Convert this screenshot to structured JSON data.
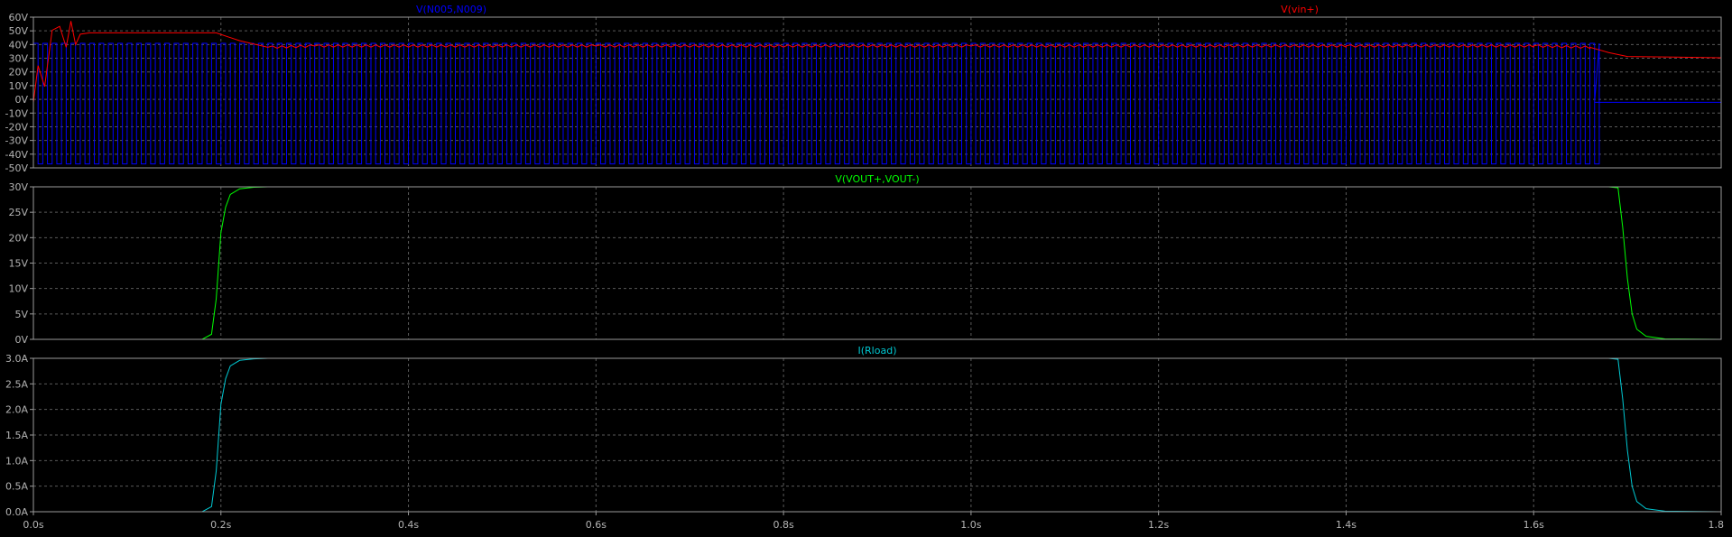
{
  "chart_data": [
    {
      "type": "line",
      "panel": "top",
      "ylim": [
        -50,
        65
      ],
      "yticks": [
        "60V",
        "50V",
        "40V",
        "30V",
        "20V",
        "10V",
        "0V",
        "-10V",
        "-20V",
        "-30V",
        "-40V",
        "-50V"
      ],
      "series": [
        {
          "name": "V(N005,N009)",
          "color": "#0000ff",
          "kind": "square_wave",
          "high": 45,
          "low": -47,
          "period": 0.01,
          "t_start": 0.0,
          "t_end": 1.665,
          "final_value": 0
        },
        {
          "name": "V(vin+)",
          "color": "#ff0000",
          "x": [
            0.0,
            0.005,
            0.012,
            0.02,
            0.028,
            0.035,
            0.04,
            0.045,
            0.05,
            0.06,
            0.1,
            0.15,
            0.195,
            0.22,
            0.25,
            0.3,
            0.6,
            1.0,
            1.4,
            1.6,
            1.66,
            1.68,
            1.7,
            1.75,
            1.8
          ],
          "y": [
            0,
            28,
            12,
            55,
            58,
            42,
            62,
            44,
            52,
            53,
            53,
            53,
            53,
            47,
            42,
            43,
            43,
            43,
            43,
            43,
            42,
            38,
            35,
            34.5,
            34
          ],
          "ripple": 1.5
        }
      ]
    },
    {
      "type": "line",
      "panel": "middle",
      "ylim": [
        0,
        30
      ],
      "yticks": [
        "30V",
        "25V",
        "20V",
        "15V",
        "10V",
        "5V",
        "0V"
      ],
      "series": [
        {
          "name": "V(VOUT+,VOUT-)",
          "color": "#00ff00",
          "x": [
            0.0,
            0.18,
            0.19,
            0.195,
            0.2,
            0.205,
            0.21,
            0.22,
            0.235,
            0.25,
            1.68,
            1.69,
            1.695,
            1.7,
            1.705,
            1.71,
            1.72,
            1.74,
            1.8
          ],
          "y": [
            0,
            0,
            1,
            8,
            21,
            26,
            28.5,
            29.6,
            29.9,
            30,
            30,
            29.8,
            22,
            12,
            5,
            2,
            0.6,
            0.1,
            0
          ]
        }
      ]
    },
    {
      "type": "line",
      "panel": "bottom",
      "ylim": [
        0,
        3
      ],
      "yticks": [
        "3.0A",
        "2.5A",
        "2.0A",
        "1.5A",
        "1.0A",
        "0.5A",
        "0.0A"
      ],
      "series": [
        {
          "name": "I(Rload)",
          "color": "#00c8d2",
          "x": [
            0.0,
            0.18,
            0.19,
            0.195,
            0.2,
            0.205,
            0.21,
            0.22,
            0.235,
            0.25,
            1.68,
            1.69,
            1.695,
            1.7,
            1.705,
            1.71,
            1.72,
            1.74,
            1.8
          ],
          "y": [
            0,
            0,
            0.1,
            0.8,
            2.1,
            2.6,
            2.85,
            2.96,
            2.99,
            3.0,
            3.0,
            2.98,
            2.2,
            1.2,
            0.5,
            0.2,
            0.06,
            0.01,
            0
          ]
        }
      ]
    }
  ],
  "x_axis": {
    "xlim": [
      0,
      1.8
    ],
    "ticks": [
      0.0,
      0.2,
      0.4,
      0.6,
      0.8,
      1.0,
      1.2,
      1.4,
      1.6,
      1.8
    ],
    "tick_labels": [
      "0.0s",
      "0.2s",
      "0.4s",
      "0.6s",
      "0.8s",
      "1.0s",
      "1.2s",
      "1.4s",
      "1.6s",
      "1.8"
    ]
  },
  "colors": {
    "background": "#000000",
    "frame": "#9a9a9a",
    "grid": "#5a5a5a",
    "tick_text": "#b4b4b4"
  },
  "grid": true
}
